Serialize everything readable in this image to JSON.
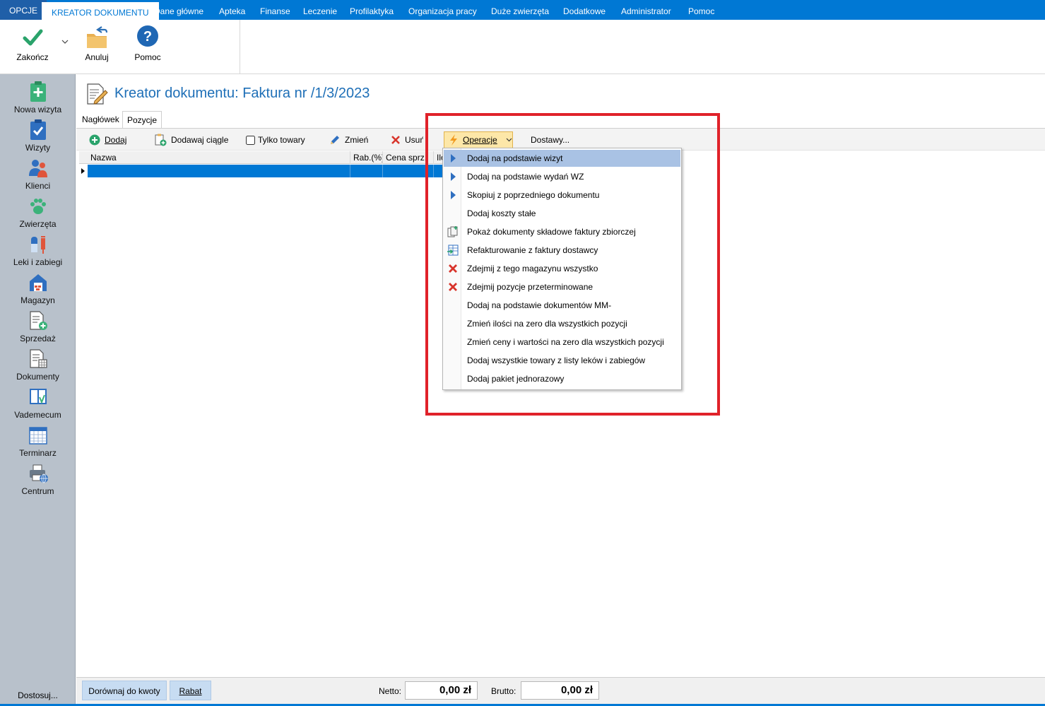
{
  "menubar": {
    "tabs": [
      {
        "label": "OPCJE"
      },
      {
        "label": "KREATOR DOKUMENTU"
      },
      {
        "label": "Dane główne"
      },
      {
        "label": "Apteka"
      },
      {
        "label": "Finanse"
      },
      {
        "label": "Leczenie"
      },
      {
        "label": "Profilaktyka"
      },
      {
        "label": "Organizacja pracy"
      },
      {
        "label": "Duże zwierzęta"
      },
      {
        "label": "Dodatkowe"
      },
      {
        "label": "Administrator"
      },
      {
        "label": "Pomoc"
      }
    ]
  },
  "ribbon": {
    "finish_label": "Zakończ",
    "cancel_label": "Anuluj",
    "help_label": "Pomoc"
  },
  "sidebar": {
    "items": [
      {
        "label": "Nowa wizyta"
      },
      {
        "label": "Wizyty"
      },
      {
        "label": "Klienci"
      },
      {
        "label": "Zwierzęta"
      },
      {
        "label": "Leki i zabiegi"
      },
      {
        "label": "Magazyn"
      },
      {
        "label": "Sprzedaż"
      },
      {
        "label": "Dokumenty"
      },
      {
        "label": "Vademecum"
      },
      {
        "label": "Terminarz"
      },
      {
        "label": "Centrum"
      }
    ],
    "footer_label": "Dostosuj..."
  },
  "document": {
    "title": "Kreator dokumentu: Faktura nr  /1/3/2023",
    "tabs": [
      {
        "label": "Nagłówek"
      },
      {
        "label": "Pozycje"
      }
    ]
  },
  "toolbar": {
    "add_label": "Dodaj",
    "add_continuous_label": "Dodawaj ciągle",
    "only_goods_label": "Tylko towary",
    "only_goods_checked": false,
    "edit_label": "Zmień",
    "delete_label": "Usuń",
    "operations_label": "Operacje",
    "deliveries_label": "Dostawy..."
  },
  "grid": {
    "columns": [
      "Nazwa",
      "Rab.(%)",
      "Cena sprz.",
      "Ilo"
    ]
  },
  "operations_menu": {
    "items": [
      {
        "label": "Dodaj na podstawie wizyt",
        "icon": "submenu-arrow-icon",
        "highlighted": true
      },
      {
        "label": "Dodaj na podstawie wydań WZ",
        "icon": "submenu-arrow-icon"
      },
      {
        "label": "Skopiuj z poprzedniego dokumentu",
        "icon": "submenu-arrow-icon"
      },
      {
        "label": "Dodaj koszty stałe",
        "icon": ""
      },
      {
        "label": "Pokaż dokumenty składowe faktury zbiorczej",
        "icon": "copy-documents-icon"
      },
      {
        "label": "Refakturowanie z faktury dostawcy",
        "icon": "import-table-icon"
      },
      {
        "label": "Zdejmij z tego magazynu wszystko",
        "icon": "red-x-icon"
      },
      {
        "label": "Zdejmij pozycje przeterminowane",
        "icon": "red-x-icon"
      },
      {
        "label": "Dodaj na podstawie dokumentów MM-",
        "icon": ""
      },
      {
        "label": "Zmień ilości na zero dla wszystkich pozycji",
        "icon": ""
      },
      {
        "label": "Zmień ceny i wartości na zero dla wszystkich pozycji",
        "icon": ""
      },
      {
        "label": "Dodaj wszystkie towary z listy leków i zabiegów",
        "icon": ""
      },
      {
        "label": "Dodaj pakiet jednorazowy",
        "icon": ""
      }
    ]
  },
  "bottombar": {
    "match_amount_label": "Dorównaj do kwoty",
    "discount_label": "Rabat",
    "net_label": "Netto:",
    "net_value": "0,00 zł",
    "gross_label": "Brutto:",
    "gross_value": "0,00 zł"
  },
  "colors": {
    "accent": "#0078d4",
    "highlight_frame": "#e0222a",
    "menu_highlight": "#a9c2e4",
    "sidebar_bg": "#b8c1cb"
  }
}
